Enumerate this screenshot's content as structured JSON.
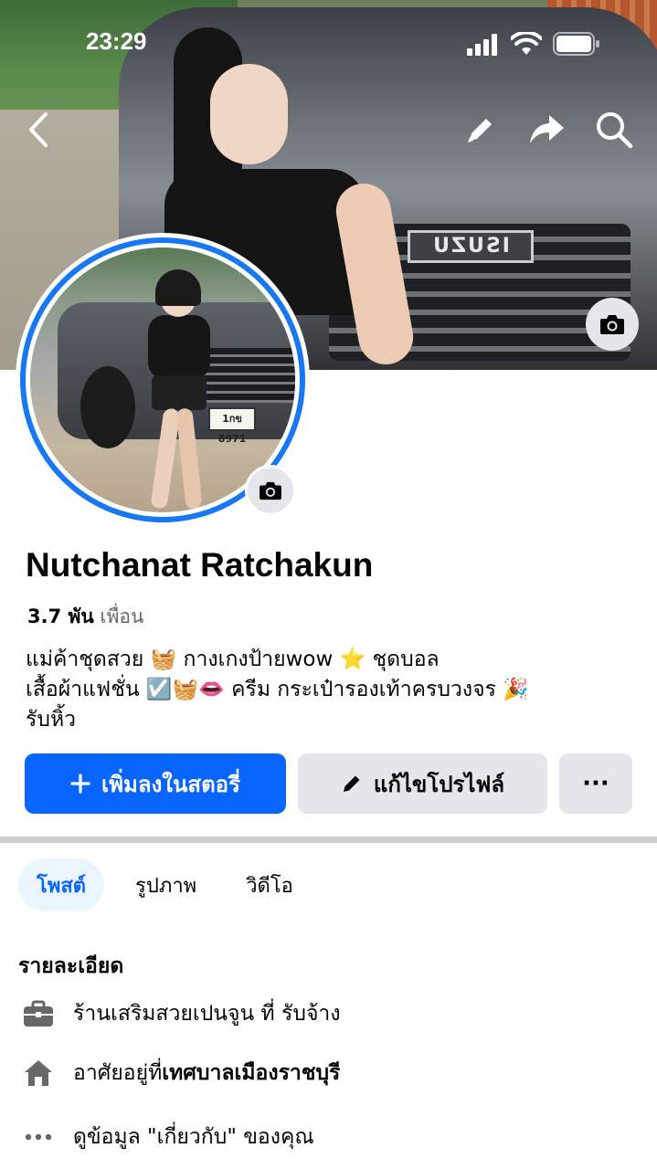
{
  "status_bar": {
    "time": "23:29"
  },
  "profile": {
    "name": "Nutchanat Ratchakun",
    "friends_count": "3.7 พัน",
    "friends_label": "เพื่อน",
    "bio_line1": "แม่ค้าชุดสวย 🧺 กางเกงป้ายwow ⭐ ชุดบอล",
    "bio_line2": "เสื้อผ้าแฟชั่น ☑️🧺👄 ครีม กระเป๋ารองเท้าครบวงจร 🎉",
    "bio_line3": "รับหิ้ว",
    "cover_badge": "ISUZU",
    "avatar_plate": "1กข 8971"
  },
  "actions": {
    "add_story": "เพิ่มลงในสตอรี่",
    "edit_profile": "แก้ไขโปรไฟล์",
    "more": "···"
  },
  "tabs": [
    {
      "label": "โพสต์",
      "active": true
    },
    {
      "label": "รูปภาพ",
      "active": false
    },
    {
      "label": "วิดีโอ",
      "active": false
    }
  ],
  "details": {
    "title": "รายละเอียด",
    "work_prefix": "ร้านเสริมสวยเปนจูน ที่ รับจ้าง",
    "lives_prefix": "อาศัยอยู่ที่ ",
    "lives_place": "เทศบาลเมืองราชบุรี",
    "about_link": "ดูข้อมูล \"เกี่ยวกับ\" ของคุณ"
  },
  "icons": [
    "back-icon",
    "edit-icon",
    "share-icon",
    "search-icon",
    "camera-icon",
    "plus-icon",
    "pencil-icon",
    "briefcase-icon",
    "home-icon",
    "more-dots-icon"
  ],
  "colors": {
    "primary": "#0866ff",
    "ring": "#1877f2",
    "secondary_bg": "#e4e6eb",
    "muted_text": "#65676b",
    "tab_active_bg": "#ebf5ff"
  }
}
